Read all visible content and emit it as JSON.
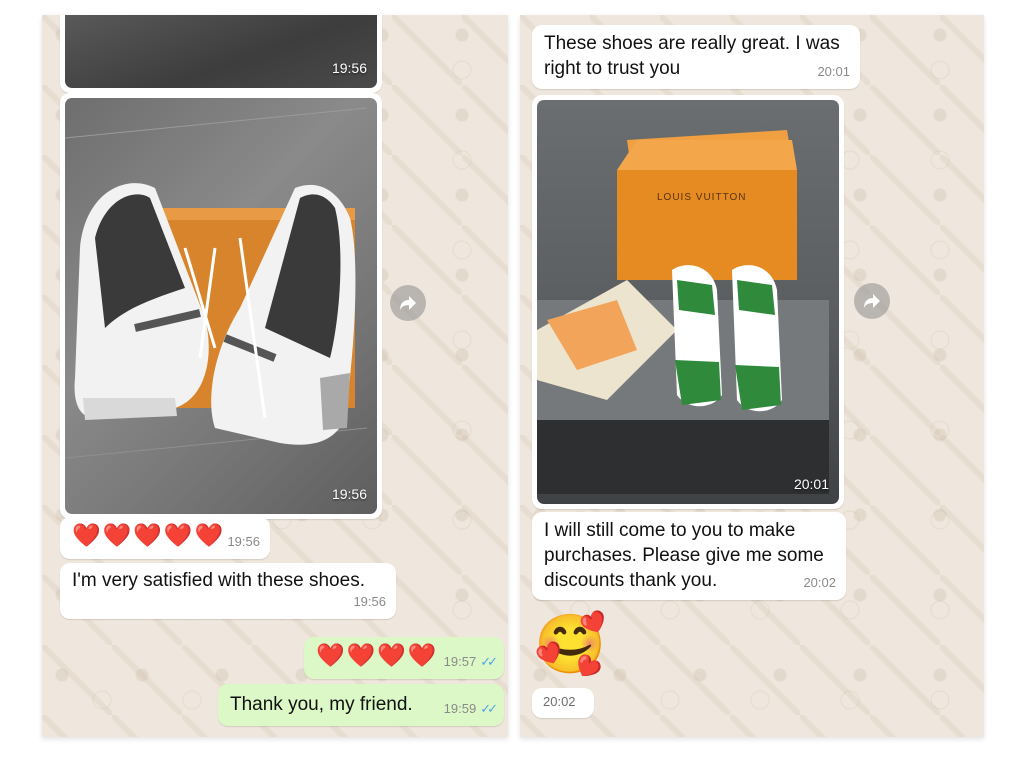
{
  "left_chat": {
    "top_image": {
      "time": "19:56"
    },
    "shoe_image": {
      "time": "19:56"
    },
    "hearts_msg": {
      "emoji": "❤️❤️❤️❤️❤️",
      "time": "19:56"
    },
    "satisfied_msg": {
      "text": "I'm very satisfied with these shoes.",
      "time": "19:56"
    },
    "out_hearts_msg": {
      "emoji": "❤️❤️❤️❤️",
      "time": "19:57"
    },
    "thank_msg": {
      "text": "Thank you, my friend.",
      "time": "19:59"
    },
    "ticks": "✓✓"
  },
  "right_chat": {
    "great_msg": {
      "text": "These shoes are really great. I was right to trust you",
      "time": "20:01"
    },
    "box_image": {
      "time": "20:01",
      "box_label": "LOUIS VUITTON"
    },
    "purchase_msg": {
      "text": "I will still come to you to make purchases. Please give me some discounts thank you.",
      "time": "20:02"
    },
    "emoji_msg": {
      "emoji": "🥰",
      "time": "20:02"
    }
  },
  "icons": {
    "forward": "forward-arrow-icon"
  },
  "colors": {
    "chat_background": "#efe7dd",
    "incoming_bubble": "#ffffff",
    "outgoing_bubble": "#dcf8c6",
    "read_ticks": "#4fa6e6"
  }
}
